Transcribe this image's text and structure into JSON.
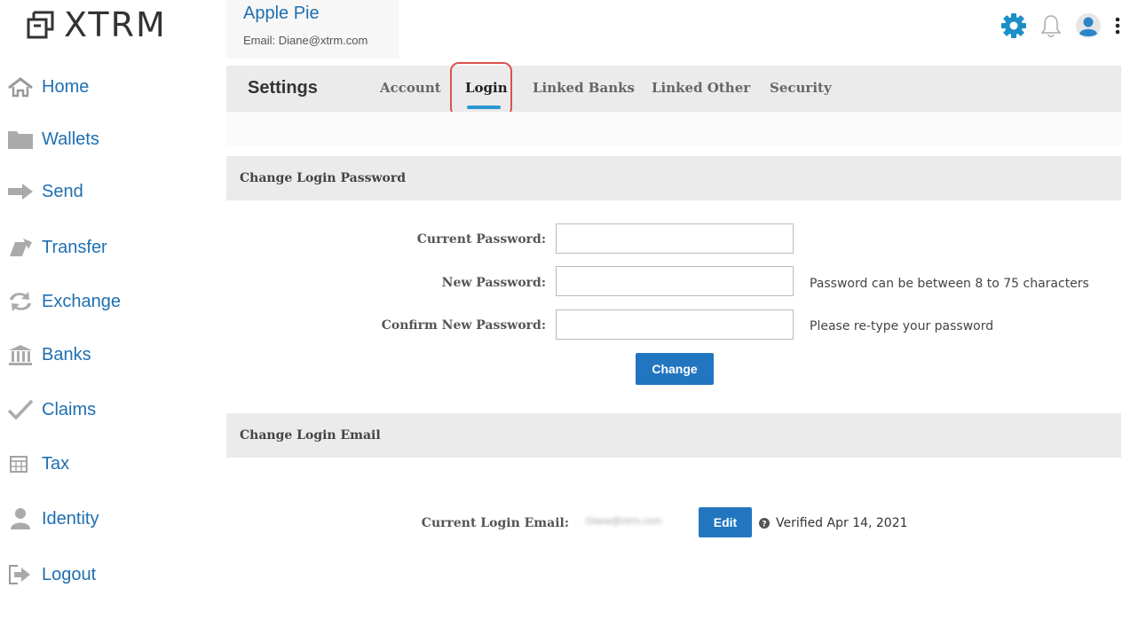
{
  "brand": {
    "name": "XTRM"
  },
  "user": {
    "name": "Apple Pie",
    "email": "Email: Diane@xtrm.com"
  },
  "sidebar": {
    "items": [
      {
        "label": "Home",
        "icon": "home-icon"
      },
      {
        "label": "Wallets",
        "icon": "folder-icon"
      },
      {
        "label": "Send",
        "icon": "arrow-right-icon"
      },
      {
        "label": "Transfer",
        "icon": "transfer-icon"
      },
      {
        "label": "Exchange",
        "icon": "exchange-icon"
      },
      {
        "label": "Banks",
        "icon": "bank-icon"
      },
      {
        "label": "Claims",
        "icon": "checkmark-icon"
      },
      {
        "label": "Tax",
        "icon": "calculator-icon"
      },
      {
        "label": "Identity",
        "icon": "person-icon"
      },
      {
        "label": "Logout",
        "icon": "logout-icon"
      }
    ]
  },
  "header_icons": [
    "gear-icon",
    "bell-icon",
    "user-avatar-icon",
    "more-vertical-icon"
  ],
  "settings": {
    "title": "Settings",
    "tabs": [
      {
        "label": "Account"
      },
      {
        "label": "Login"
      },
      {
        "label": "Linked Banks"
      },
      {
        "label": "Linked Other"
      },
      {
        "label": "Security"
      }
    ],
    "active_tab": "Login"
  },
  "password_section": {
    "title": "Change Login Password",
    "current_label": "Current Password:",
    "new_label": "New Password:",
    "new_hint": "Password can be between 8 to 75 characters",
    "confirm_label": "Confirm New Password:",
    "confirm_hint": "Please re-type your password",
    "button": "Change"
  },
  "email_section": {
    "title": "Change Login Email",
    "current_label": "Current Login Email:",
    "current_value": "Diane@xtrm.com",
    "button": "Edit",
    "verified": "Verified Apr 14, 2021"
  },
  "colors": {
    "accent": "#1f6fb2",
    "button": "#2276bf",
    "tab_underline": "#2a96d0",
    "highlight": "#d9534f",
    "gear": "#1a8fc9"
  }
}
